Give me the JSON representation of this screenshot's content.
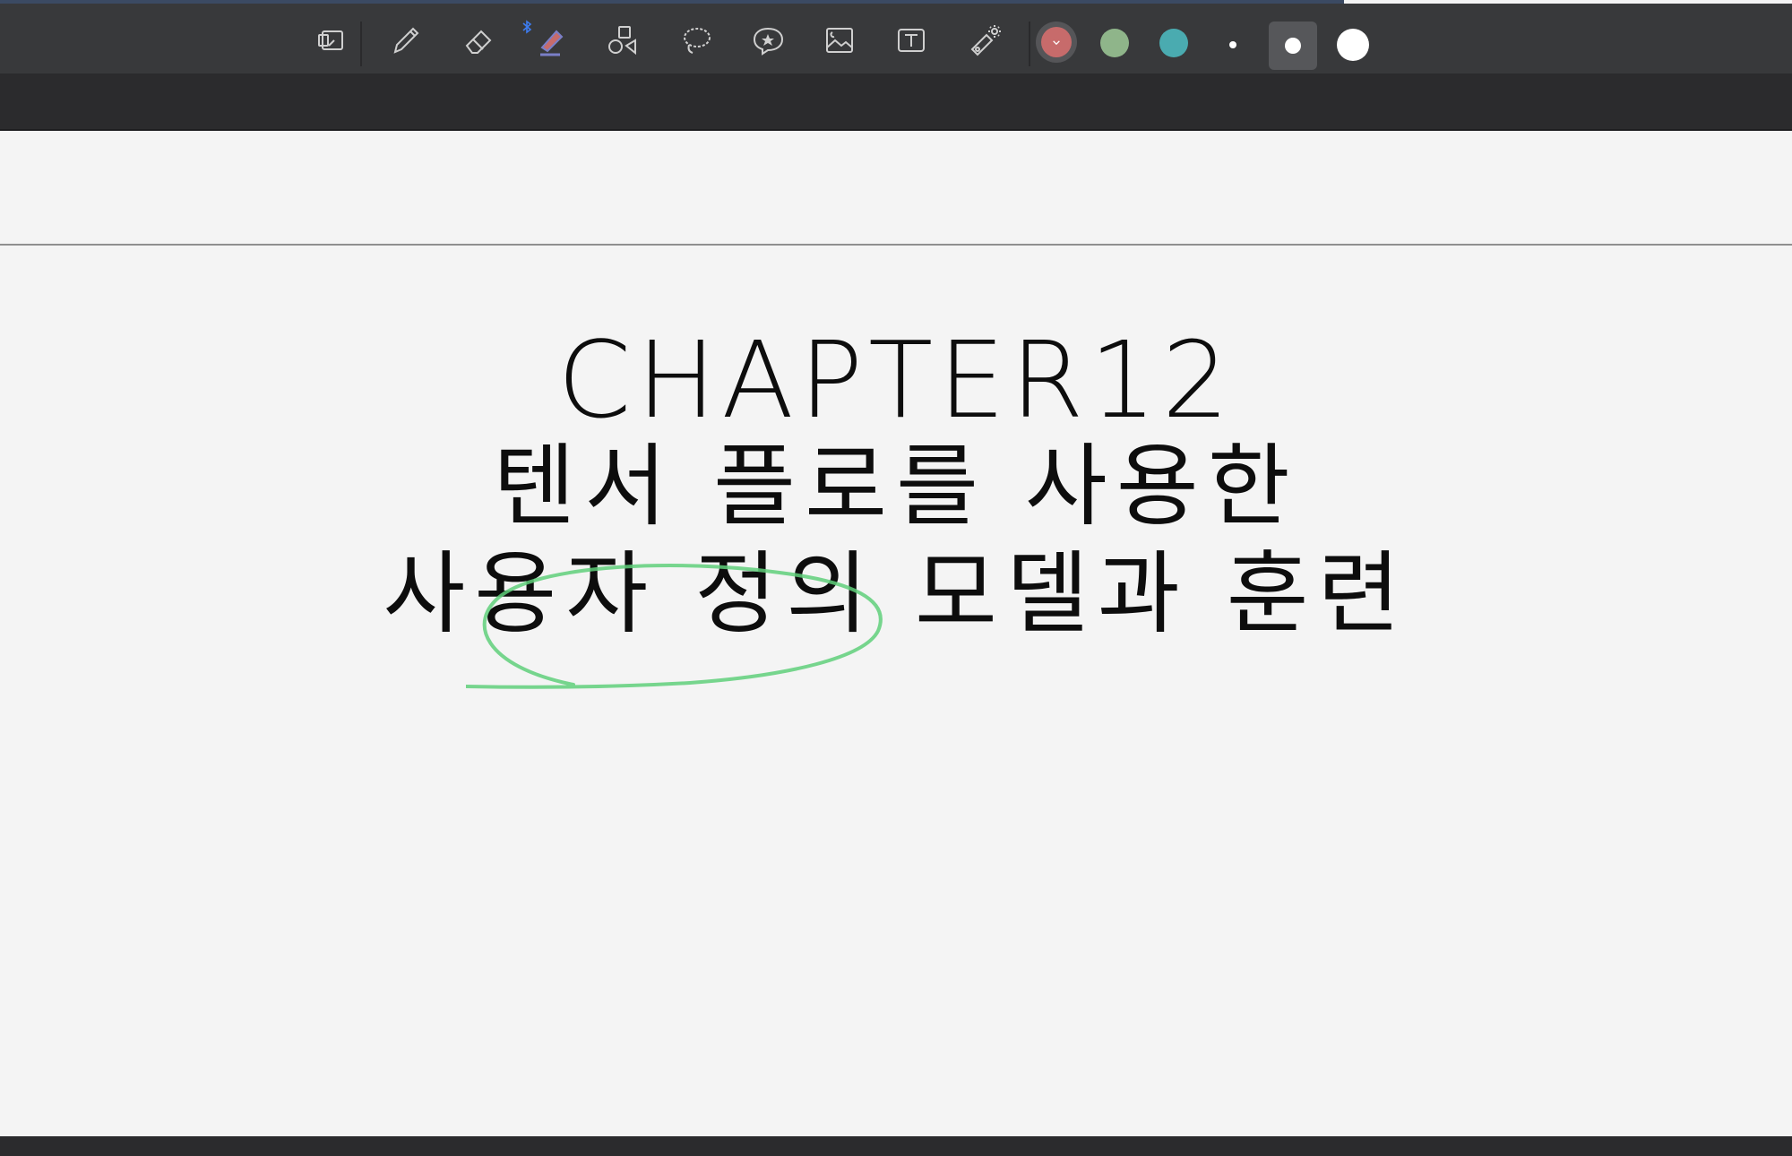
{
  "toolbar": {
    "tools": [
      {
        "name": "page-view-icon"
      },
      {
        "name": "pen-icon"
      },
      {
        "name": "eraser-icon"
      },
      {
        "name": "highlighter-icon",
        "active": true,
        "bluetooth": true
      },
      {
        "name": "shapes-icon"
      },
      {
        "name": "lasso-icon"
      },
      {
        "name": "sticker-icon"
      },
      {
        "name": "image-icon"
      },
      {
        "name": "text-box-icon"
      },
      {
        "name": "laser-pointer-icon"
      }
    ],
    "colors": [
      "#c76b6b",
      "#8fb58a",
      "#4aabb0"
    ],
    "selected_color": "#c76b6b",
    "stroke_sizes": [
      "small",
      "medium",
      "large"
    ],
    "selected_size": "medium"
  },
  "document": {
    "title_line1": "CHAPTER12",
    "title_line2": "텐서 플로를 사용한",
    "title_line3": "사용자 정의 모델과 훈련",
    "annotation_color": "#5fcf7a"
  }
}
